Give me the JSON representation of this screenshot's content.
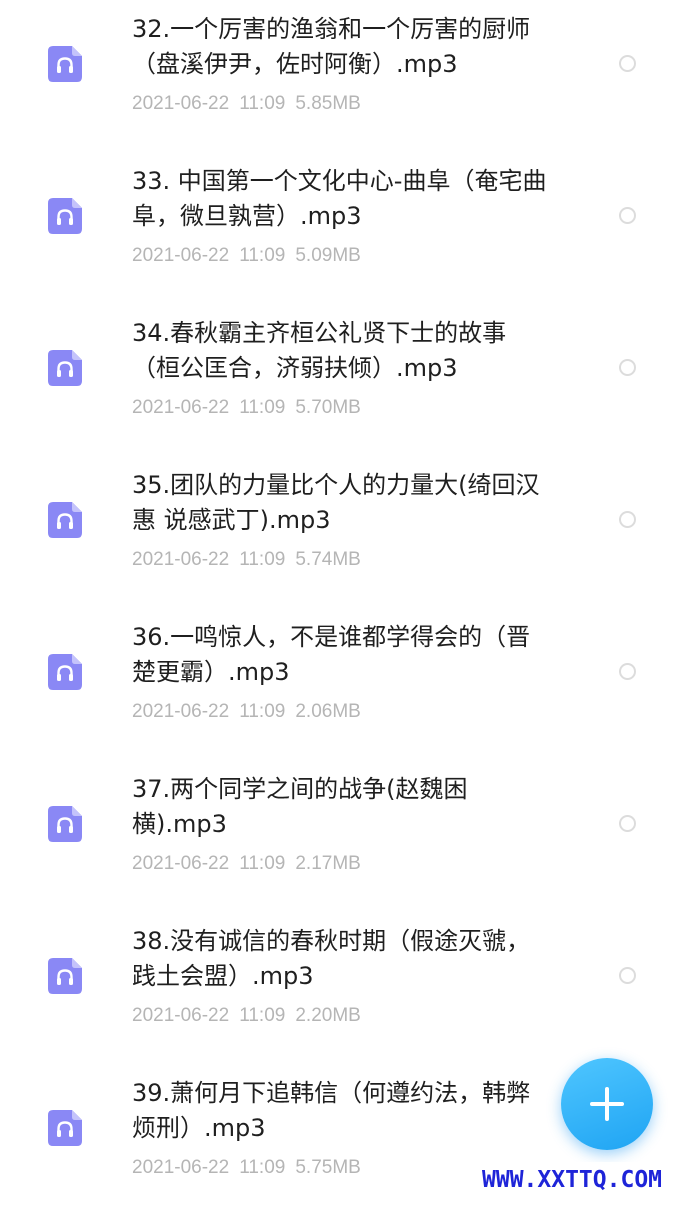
{
  "items": [
    {
      "line1": "32.一个厉害的渔翁和一个厉害的厨师",
      "line2": "（盘溪伊尹，佐时阿衡）.mp3",
      "date": "2021-06-22",
      "time": "11:09",
      "size": "5.85MB",
      "icon": "audio-file-icon"
    },
    {
      "line1": "33. 中国第一个文化中心-曲阜（奄宅曲",
      "line2": "阜，微旦孰营）.mp3",
      "date": "2021-06-22",
      "time": "11:09",
      "size": "5.09MB",
      "icon": "audio-file-icon"
    },
    {
      "line1": "34.春秋霸主齐桓公礼贤下士的故事",
      "line2": "（桓公匡合，济弱扶倾）.mp3",
      "date": "2021-06-22",
      "time": "11:09",
      "size": "5.70MB",
      "icon": "audio-file-icon"
    },
    {
      "line1": "35.团队的力量比个人的力量大(绮回汉",
      "line2": "惠 说感武丁).mp3",
      "date": "2021-06-22",
      "time": "11:09",
      "size": "5.74MB",
      "icon": "audio-file-icon"
    },
    {
      "line1": "36.一鸣惊人，不是谁都学得会的（晋",
      "line2": "楚更霸）.mp3",
      "date": "2021-06-22",
      "time": "11:09",
      "size": "2.06MB",
      "icon": "audio-file-icon"
    },
    {
      "line1": "37.两个同学之间的战争(赵魏困",
      "line2": "横).mp3",
      "date": "2021-06-22",
      "time": "11:09",
      "size": "2.17MB",
      "icon": "audio-file-icon"
    },
    {
      "line1": "38.没有诚信的春秋时期（假途灭虢，",
      "line2": "践土会盟）.mp3",
      "date": "2021-06-22",
      "time": "11:09",
      "size": "2.20MB",
      "icon": "audio-file-icon"
    },
    {
      "line1": "39.萧何月下追韩信（何遵约法，韩弊",
      "line2": "烦刑）.mp3",
      "date": "2021-06-22",
      "time": "11:09",
      "size": "5.75MB",
      "icon": "audio-file-icon"
    }
  ],
  "fab": {
    "icon": "plus-icon"
  },
  "watermark": "WWW.XXTTQ.COM",
  "colors": {
    "icon_purple": "#8a88f5",
    "fab_blue": "#22a8f5",
    "meta_gray": "#b5b5b5",
    "watermark_blue": "#1e24d8"
  }
}
